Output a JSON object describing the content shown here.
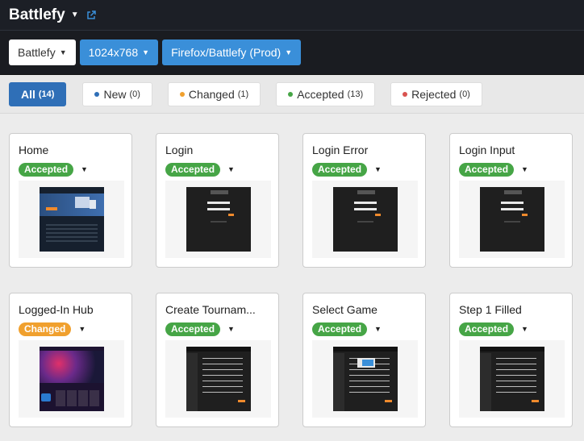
{
  "app": {
    "title": "Battlefy"
  },
  "toolbar": {
    "project": "Battlefy",
    "resolution": "1024x768",
    "browser": "Firefox/Battlefy (Prod)"
  },
  "filters": [
    {
      "label": "All",
      "count": "(14)",
      "active": true
    },
    {
      "label": "New",
      "count": "(0)",
      "dot_color": "#2f6fb7"
    },
    {
      "label": "Changed",
      "count": "(1)",
      "dot_color": "#f0a02e"
    },
    {
      "label": "Accepted",
      "count": "(13)",
      "dot_color": "#46a546"
    },
    {
      "label": "Rejected",
      "count": "(0)",
      "dot_color": "#d9534f"
    }
  ],
  "cards": [
    {
      "title": "Home",
      "status": "Accepted"
    },
    {
      "title": "Login",
      "status": "Accepted"
    },
    {
      "title": "Login Error",
      "status": "Accepted"
    },
    {
      "title": "Login Input",
      "status": "Accepted"
    },
    {
      "title": "Logged-In Hub",
      "status": "Changed"
    },
    {
      "title": "Create Tournam...",
      "status": "Accepted"
    },
    {
      "title": "Select Game",
      "status": "Accepted"
    },
    {
      "title": "Step 1 Filled",
      "status": "Accepted"
    }
  ],
  "colors": {
    "accent": "#3a8fd9",
    "accepted": "#46a546",
    "changed": "#f0a02e",
    "rejected": "#d9534f"
  }
}
